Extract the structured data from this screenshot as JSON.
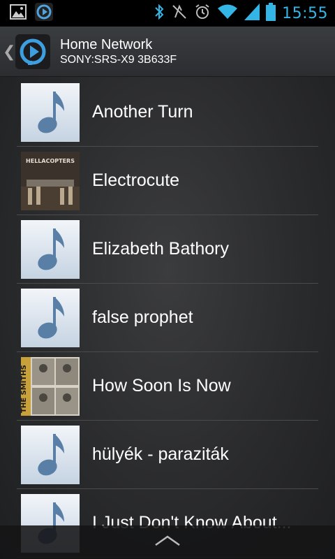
{
  "status_bar": {
    "time": "15:55",
    "icons": [
      "gallery-icon",
      "app-icon",
      "bluetooth-icon",
      "mute-icon",
      "alarm-icon",
      "wifi-icon",
      "signal-icon",
      "battery-icon"
    ],
    "accent_color": "#33b5e5"
  },
  "header": {
    "title": "Home Network",
    "subtitle": "SONY:SRS-X9 3B633F"
  },
  "tracks": [
    {
      "title": "Another Turn",
      "art": "music-note-icon"
    },
    {
      "title": "Electrocute",
      "art": "album-art"
    },
    {
      "title": "Elizabeth Bathory",
      "art": "music-note-icon"
    },
    {
      "title": "false prophet",
      "art": "music-note-icon"
    },
    {
      "title": "How Soon Is Now",
      "art": "album-art"
    },
    {
      "title": "hülyék - paraziták",
      "art": "music-note-icon"
    },
    {
      "title": "I Just Don't Know About...",
      "art": "music-note-icon"
    }
  ],
  "album_art_text": {
    "electrocute_band": "HELLACOPTERS",
    "how_soon_band": "THE SMITHS"
  },
  "bottom_bar": {
    "icon": "chevron-up-icon"
  }
}
